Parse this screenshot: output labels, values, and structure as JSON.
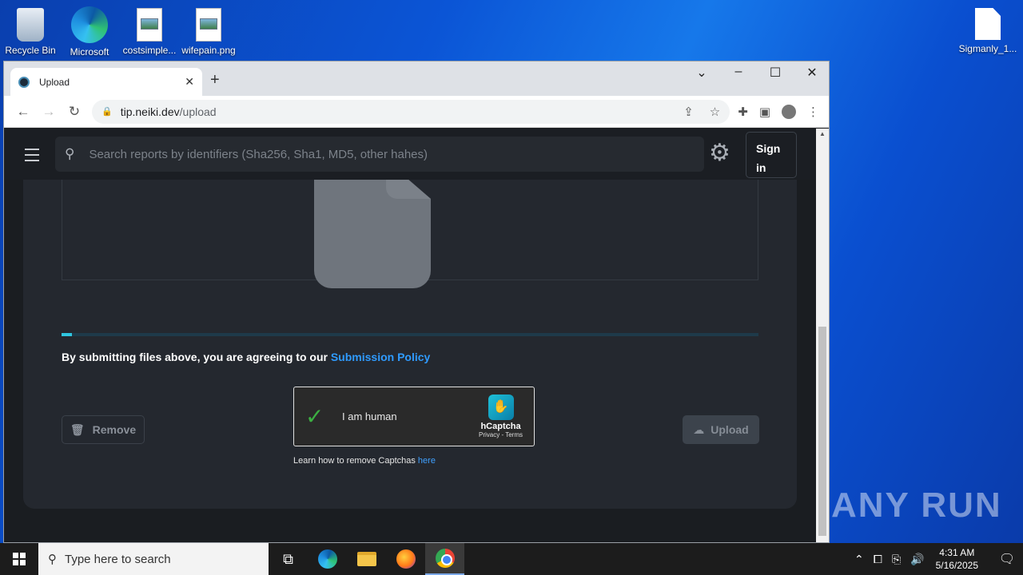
{
  "desktop": {
    "icons": [
      {
        "label": "Recycle Bin"
      },
      {
        "label": "Microsoft"
      },
      {
        "label": "costsimple..."
      },
      {
        "label": "wifepain.png"
      },
      {
        "label": "Sigmanly_1..."
      }
    ],
    "watermark": "ANY RUN"
  },
  "browser": {
    "tab_title": "Upload",
    "url_host": "tip.neiki.dev",
    "url_path": "/upload"
  },
  "page": {
    "search_placeholder": "Search reports by identifiers (Sha256, Sha1, MD5, other hahes)",
    "sign_in_label": "Sign in",
    "upload_progress_percent": 1.5,
    "policy_text": "By submitting files above, you are agreeing to our ",
    "policy_link": "Submission Policy",
    "remove_label": "Remove",
    "upload_label": "Upload",
    "captcha": {
      "label": "I am human",
      "brand": "hCaptcha",
      "links": "Privacy - Terms"
    },
    "learn_text": "Learn how to remove Captchas ",
    "learn_link": "here"
  },
  "taskbar": {
    "search_placeholder": "Type here to search",
    "time": "4:31 AM",
    "date": "5/16/2025"
  }
}
